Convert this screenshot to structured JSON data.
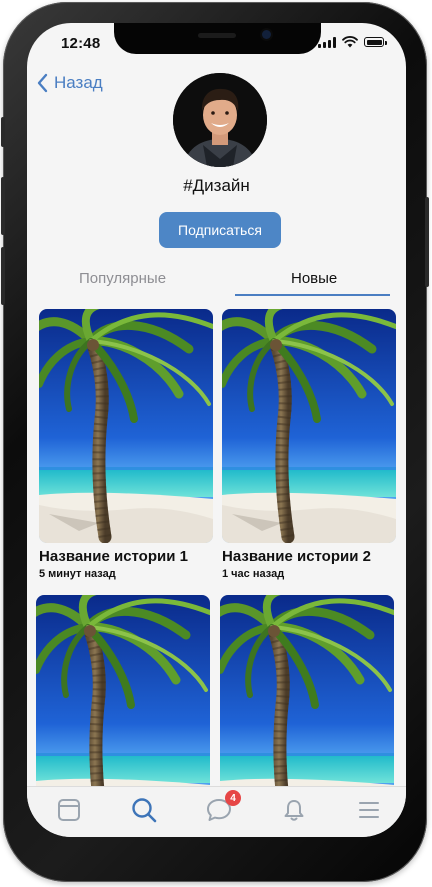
{
  "status_bar": {
    "time": "12:48"
  },
  "header": {
    "back_label": "Назад",
    "title": "#Дизайн"
  },
  "subscribe_label": "Подписаться",
  "tabs": [
    {
      "label": "Популярные",
      "active": false
    },
    {
      "label": "Новые",
      "active": true
    }
  ],
  "stories": [
    {
      "title": "Название истории 1",
      "time": "5 минут назад"
    },
    {
      "title": "Название истории 2",
      "time": "1 час назад"
    },
    {
      "title": "",
      "time": ""
    },
    {
      "title": "",
      "time": ""
    }
  ],
  "bottom_nav": {
    "items": [
      "feed-icon",
      "search-icon",
      "messages-icon",
      "bell-icon",
      "menu-icon"
    ],
    "active": "search-icon",
    "messages_badge": "4"
  },
  "colors": {
    "accent": "#4d86c6",
    "link": "#4a7ec2",
    "badge": "#e64646"
  }
}
